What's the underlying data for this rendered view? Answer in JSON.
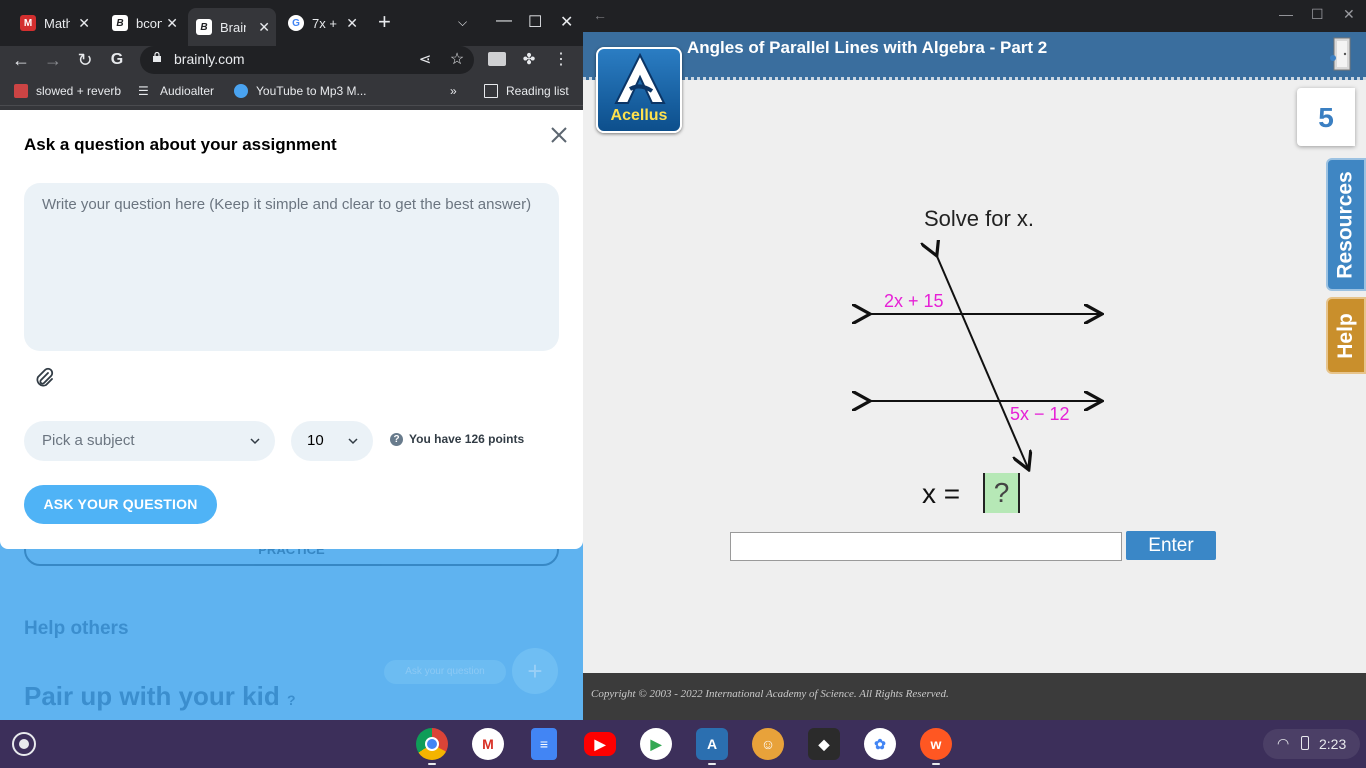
{
  "browser": {
    "tabs": [
      {
        "title": "Math",
        "favicon": "M",
        "favicon_color": "#d32f2f"
      },
      {
        "title": "bcon",
        "favicon": "B",
        "favicon_color": "#202124"
      },
      {
        "title": "Brain",
        "favicon": "B",
        "favicon_color": "#202124"
      },
      {
        "title": "7x +",
        "favicon": "G",
        "favicon_color": "#4285f4"
      }
    ],
    "url": "brainly.com",
    "bookmarks": [
      {
        "label": "slowed + reverb"
      },
      {
        "label": "Audioalter"
      },
      {
        "label": "YouTube to Mp3 M..."
      },
      {
        "label": "Reading list"
      }
    ]
  },
  "brainly_bg": {
    "practice_label": "PRACTICE",
    "help_others": "Help others",
    "pair_up": "Pair up with your kid",
    "ask_small": "Ask your question"
  },
  "modal": {
    "title": "Ask a question about your assignment",
    "question_placeholder": "Write your question here (Keep it simple and clear to get the best answer)",
    "subject_placeholder": "Pick a subject",
    "points_value": "10",
    "points_info": "You have 126 points",
    "ask_button": "ASK YOUR QUESTION"
  },
  "acellus": {
    "title": "Angles of Parallel Lines with Algebra - Part 2",
    "logo_text": "Acellus",
    "question_number": "5",
    "resources_tab": "Resources",
    "help_tab": "Help",
    "prompt": "Solve for x.",
    "angle1_label": "2x + 15",
    "angle2_label": "5x − 12",
    "equation_lhs": "x =",
    "answer_placeholder_glyph": "?",
    "enter_button": "Enter",
    "copyright": "Copyright © 2003 - 2022 International Academy of Science.  All Rights Reserved."
  },
  "shelf": {
    "time": "2:23",
    "apps": [
      "Chrome",
      "Gmail",
      "Docs",
      "YouTube",
      "Play Store",
      "Acellus",
      "Game",
      "Roblox",
      "Photos",
      "Wattpad"
    ]
  },
  "colors": {
    "acellus_header": "#3a6e9e",
    "angle_label": "#e620d6",
    "enter_button": "#3a87c7",
    "brainly_button": "#4fb3f6"
  }
}
